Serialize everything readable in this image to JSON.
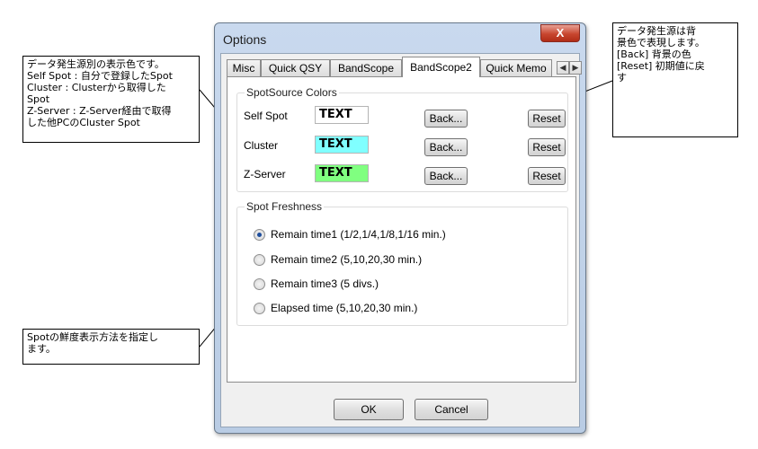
{
  "callouts": {
    "left_top": "データ発生源別の表示色です。\nSelf Spot : 自分で登録したSpot\nCluster : Clusterから取得した\nSpot\nZ-Server : Z-Server経由で取得\nした他PCのCluster Spot",
    "right_top": "データ発生源は背\n景色で表現します。\n[Back] 背景の色\n[Reset] 初期値に戻\nす",
    "left_bottom": "Spotの鮮度表示方法を指定し\nます。"
  },
  "dialog": {
    "title": "Options",
    "close_glyph": "X",
    "tabs": [
      "Misc",
      "Quick QSY",
      "BandScope",
      "BandScope2",
      "Quick Memo"
    ],
    "active_tab": "BandScope2",
    "scroll_left": "◀",
    "scroll_right": "▶",
    "spot_source": {
      "group_label": "SpotSource Colors",
      "rows": [
        {
          "label": "Self Spot",
          "sample": "TEXT",
          "color": "#ffffff",
          "back": "Back...",
          "reset": "Reset"
        },
        {
          "label": "Cluster",
          "sample": "TEXT",
          "color": "#80ffff",
          "back": "Back...",
          "reset": "Reset"
        },
        {
          "label": "Z-Server",
          "sample": "TEXT",
          "color": "#80ff80",
          "back": "Back...",
          "reset": "Reset"
        }
      ]
    },
    "freshness": {
      "group_label": "Spot Freshness",
      "options": [
        {
          "label": "Remain time1 (1/2,1/4,1/8,1/16 min.)",
          "checked": true
        },
        {
          "label": "Remain time2 (5,10,20,30 min.)",
          "checked": false
        },
        {
          "label": "Remain time3 (5 divs.)",
          "checked": false
        },
        {
          "label": "Elapsed time (5,10,20,30 min.)",
          "checked": false
        }
      ]
    },
    "ok": "OK",
    "cancel": "Cancel"
  }
}
